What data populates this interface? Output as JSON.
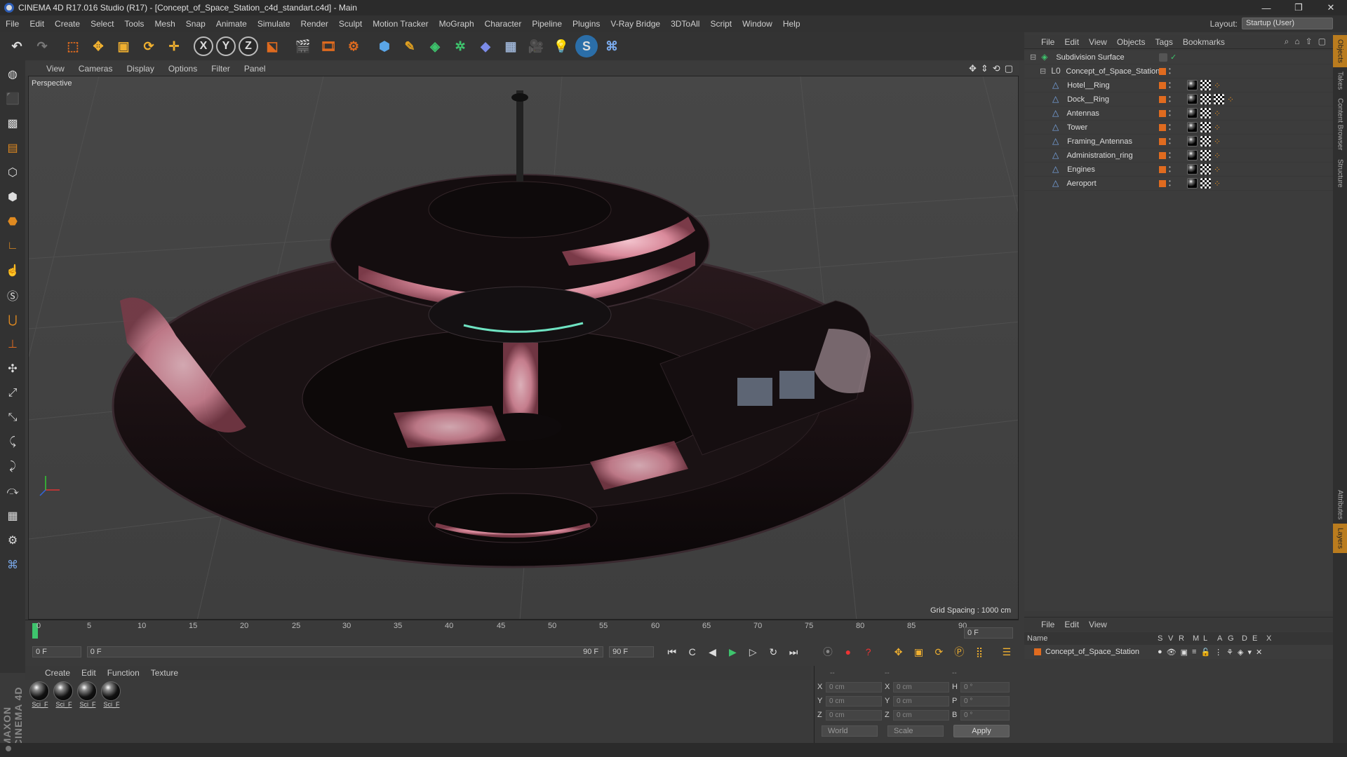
{
  "app": {
    "title": "CINEMA 4D R17.016 Studio (R17) - [Concept_of_Space_Station_c4d_standart.c4d] - Main"
  },
  "window_controls": [
    "—",
    "❐",
    "✕"
  ],
  "menubar": {
    "items": [
      "File",
      "Edit",
      "Create",
      "Select",
      "Tools",
      "Mesh",
      "Snap",
      "Animate",
      "Simulate",
      "Render",
      "Sculpt",
      "Motion Tracker",
      "MoGraph",
      "Character",
      "Pipeline",
      "Plugins",
      "V-Ray Bridge",
      "3DToAll",
      "Script",
      "Window",
      "Help"
    ],
    "layout_label": "Layout:",
    "layout_value": "Startup (User)"
  },
  "viewport": {
    "menu": [
      "View",
      "Cameras",
      "Display",
      "Options",
      "Filter",
      "Panel"
    ],
    "camera_name": "Perspective",
    "grid_spacing": "Grid Spacing : 1000 cm"
  },
  "timeline": {
    "ticks": [
      "0",
      "5",
      "10",
      "15",
      "20",
      "25",
      "30",
      "35",
      "40",
      "45",
      "50",
      "55",
      "60",
      "65",
      "70",
      "75",
      "80",
      "85",
      "90"
    ],
    "frame_end_field": "0 F"
  },
  "transport": {
    "current_frame": "0 F",
    "range_start": "0 F",
    "range_end": "90 F",
    "max_frame": "90 F"
  },
  "materials": {
    "menu": [
      "Create",
      "Edit",
      "Function",
      "Texture"
    ],
    "items": [
      "Sci_F",
      "Sci_F",
      "Sci_F",
      "Sci_F"
    ]
  },
  "coordinates": {
    "header_left": "--",
    "header_mid": "--",
    "header_right": "--",
    "rows": [
      {
        "a": "X",
        "av": "0 cm",
        "b": "X",
        "bv": "0 cm",
        "c": "H",
        "cv": "0 °"
      },
      {
        "a": "Y",
        "av": "0 cm",
        "b": "Y",
        "bv": "0 cm",
        "c": "P",
        "cv": "0 °"
      },
      {
        "a": "Z",
        "av": "0 cm",
        "b": "Z",
        "bv": "0 cm",
        "c": "B",
        "cv": "0 °"
      }
    ],
    "space": "World",
    "mode": "Scale",
    "apply": "Apply"
  },
  "objects": {
    "menu": [
      "File",
      "Edit",
      "View",
      "Objects",
      "Tags",
      "Bookmarks"
    ],
    "root": "Subdivision Surface",
    "group": "Concept_of_Space_Station",
    "children": [
      "Hotel__Ring",
      "Dock__Ring",
      "Antennas",
      "Tower",
      "Framing_Antennas",
      "Administration_ring",
      "Engines",
      "Aeroport"
    ]
  },
  "layers": {
    "menu": [
      "File",
      "Edit",
      "View"
    ],
    "columns": [
      "Name",
      "S",
      "V",
      "R",
      "M",
      "L",
      "A",
      "G",
      "D",
      "E",
      "X"
    ],
    "row_name": "Concept_of_Space_Station"
  },
  "side_tabs": [
    "Objects",
    "Takes",
    "Content Browser",
    "Structure"
  ],
  "side_tabs_bottom": [
    "Attributes",
    "Layers"
  ],
  "colors": {
    "accent_orange": "#e06b1f",
    "tab_active": "#ba7c1e",
    "station_glow": "#e7a0ae"
  }
}
